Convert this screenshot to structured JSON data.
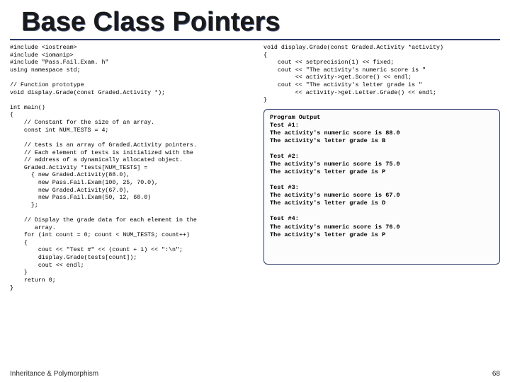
{
  "title": "Base Class Pointers",
  "footer": "Inheritance & Polymorphism",
  "page_number": "68",
  "code_left": "#include <iostream>\n#include <iomanip>\n#include \"Pass.Fail.Exam. h\"\nusing namespace std;\n\n// Function prototype\nvoid display.Grade(const Graded.Activity *);\n\nint main()\n{\n    // Constant for the size of an array.\n    const int NUM_TESTS = 4;\n\n    // tests is an array of Graded.Activity pointers.\n    // Each element of tests is initialized with the\n    // address of a dynamically allocated object.\n    Graded.Activity *tests[NUM_TESTS] =\n      { new Graded.Activity(88.0),\n        new Pass.Fail.Exam(100, 25, 70.0),\n        new Graded.Activity(67.0),\n        new Pass.Fail.Exam(50, 12, 60.0)\n      };\n\n    // Display the grade data for each element in the\n       array.\n    for (int count = 0; count < NUM_TESTS; count++)\n    {\n        cout << \"Test #\" << (count + 1) << \":\\n\";\n        display.Grade(tests[count]);\n        cout << endl;\n    }\n    return 0;\n}",
  "code_right": "void display.Grade(const Graded.Activity *activity)\n{\n    cout << setprecision(1) << fixed;\n    cout << \"The activity's numeric score is \"\n         << activity->get.Score() << endl;\n    cout << \"The activity's letter grade is \"\n         << activity->get.Letter.Grade() << endl;\n}",
  "program_output": "Program Output\nTest #1:\nThe activity's numeric score is 88.0\nThe activity's letter grade is B\n\nTest #2:\nThe activity's numeric score is 75.0\nThe activity's letter grade is P\n\nTest #3:\nThe activity's numeric score is 67.0\nThe activity's letter grade is D\n\nTest #4:\nThe activity's numeric score is 76.0\nThe activity's letter grade is P"
}
